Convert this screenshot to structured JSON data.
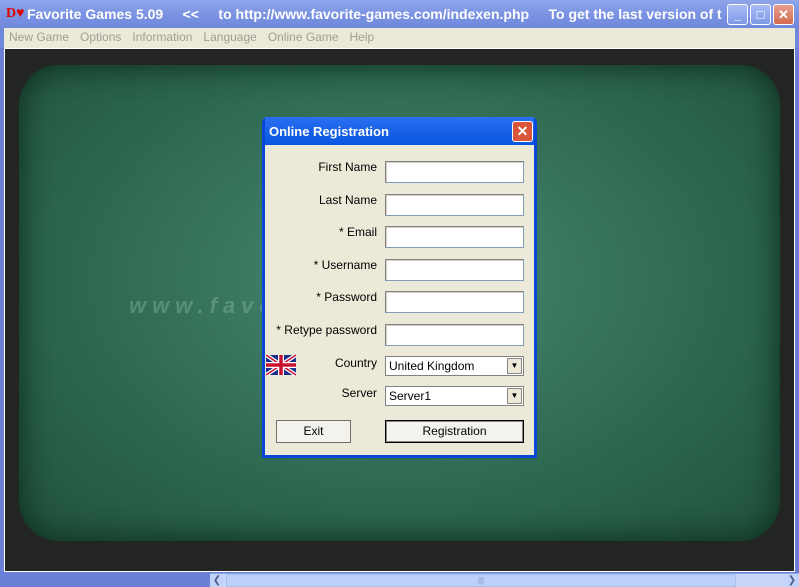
{
  "window": {
    "logo": "D♥",
    "title": "Favorite Games 5.09     <<     to http://www.favorite-games.com/indexen.php     To get the last version of the..."
  },
  "menu": [
    "New Game",
    "Options",
    "Information",
    "Language",
    "Online Game",
    "Help"
  ],
  "watermark": "www.favorite-games.com",
  "dialog": {
    "title": "Online Registration",
    "fields": [
      {
        "label": "First Name",
        "value": ""
      },
      {
        "label": "Last Name",
        "value": ""
      },
      {
        "label": "* Email",
        "value": ""
      },
      {
        "label": "* Username",
        "value": ""
      },
      {
        "label": "* Password",
        "value": ""
      },
      {
        "label": "* Retype password",
        "value": ""
      }
    ],
    "country": {
      "label": "Country",
      "value": "United Kingdom"
    },
    "server": {
      "label": "Server",
      "value": "Server1"
    },
    "exit_label": "Exit",
    "register_label": "Registration"
  }
}
